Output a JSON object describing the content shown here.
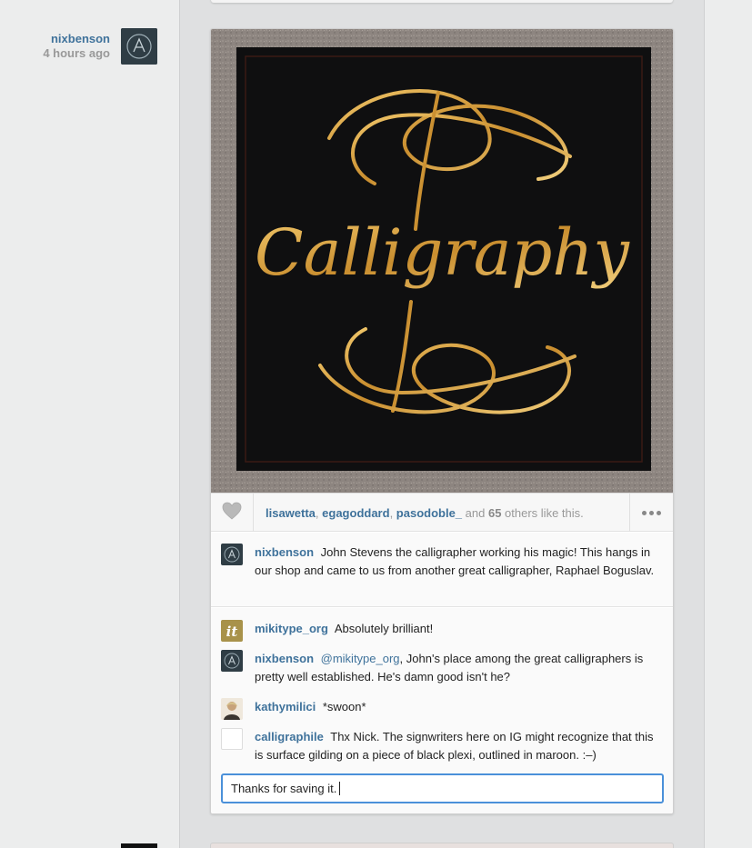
{
  "post": {
    "author": "nixbenson",
    "time_ago": "4 hours ago",
    "photo_text": "Calligraphy",
    "likes": {
      "users": [
        "lisawetta",
        "egagoddard",
        "pasodoble_"
      ],
      "sep1": ", ",
      "sep2": ", ",
      "and_text": " and ",
      "count": "65",
      "suffix": " others like this."
    },
    "caption": {
      "user": "nixbenson",
      "text": "John Stevens the calligrapher working his magic! This hangs in our shop and came to us from another great calligrapher, Raphael Boguslav."
    },
    "comments": [
      {
        "user": "mikitype_org",
        "text": "Absolutely brilliant!"
      },
      {
        "user": "nixbenson",
        "mention": "@mikitype_org",
        "text": ", John's place among the great calligraphers is pretty well established. He's damn good isn't he?"
      },
      {
        "user": "kathymilici",
        "text": "*swoon*"
      },
      {
        "user": "calligraphile",
        "text": "Thx Nick. The signwriters here on IG might recognize that this is surface gilding on a piece of black plexi, outlined in maroon. :–)"
      }
    ],
    "reply_value": "Thanks for saving it."
  },
  "colors": {
    "link": "#3f729b",
    "gold": "#d9a441",
    "focus": "#4a90d9"
  },
  "icons": [
    "heart-icon",
    "more-options-icon"
  ]
}
